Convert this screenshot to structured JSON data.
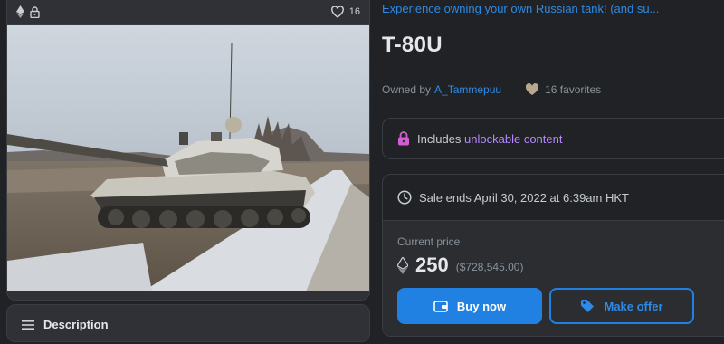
{
  "card": {
    "favorites_count": "16",
    "icons": [
      "ethereum-icon",
      "lock-icon",
      "heart-icon"
    ],
    "image_description_icon": "tank-photo"
  },
  "description": {
    "label": "Description"
  },
  "item": {
    "collection_link": "Experience owning your own Russian tank! (and su...",
    "title": "T-80U",
    "owned_by_label": "Owned by",
    "owner": "A_Tammepuu",
    "favorites_label": "16 favorites"
  },
  "unlockable": {
    "prefix": "Includes ",
    "highlight": "unlockable content"
  },
  "sale": {
    "ends": "Sale ends April 30, 2022 at 6:39am HKT",
    "current_price_label": "Current price",
    "price": "250",
    "price_usd": "($728,545.00)",
    "buy_now_label": "Buy now",
    "make_offer_label": "Make offer"
  },
  "colors": {
    "background": "#202225",
    "accent": "#2081e2",
    "link": "#2e8ae6",
    "unlockable": "#b488ff"
  }
}
